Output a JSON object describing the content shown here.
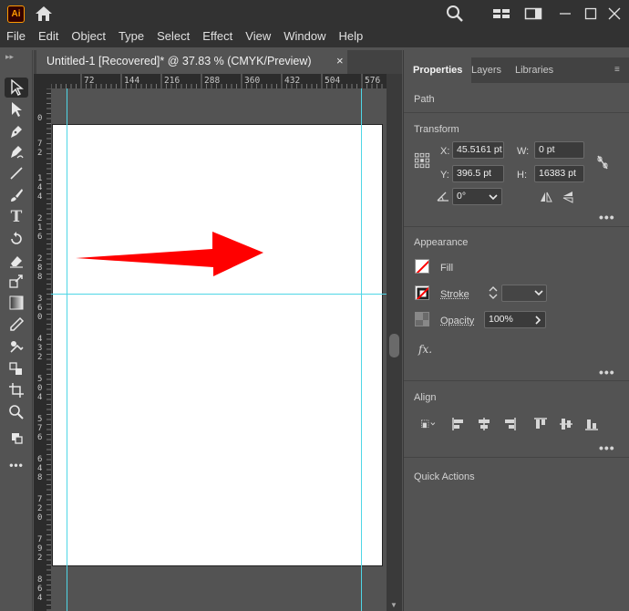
{
  "app": {
    "logo_text": "Ai"
  },
  "menu": [
    "File",
    "Edit",
    "Object",
    "Type",
    "Select",
    "Effect",
    "View",
    "Window",
    "Help"
  ],
  "document": {
    "tab_title": "Untitled-1 [Recovered]* @ 37.83 % (CMYK/Preview)",
    "close_glyph": "×"
  },
  "ruler": {
    "h_labels": [
      "72",
      "144",
      "216",
      "288",
      "360",
      "432",
      "504",
      "576"
    ],
    "v_labels": [
      "0",
      "7\n2",
      "1\n4\n4",
      "2\n1\n6",
      "2\n8\n8",
      "3\n6\n0",
      "4\n3\n2",
      "5\n0\n4",
      "5\n7\n6",
      "6\n4\n8",
      "7\n2\n0",
      "7\n9\n2",
      "8\n6\n4"
    ]
  },
  "canvas": {
    "arrow_color": "#ff0000",
    "guide_color": "#4fd6e6"
  },
  "panel": {
    "tabs": [
      "Properties",
      "Layers",
      "Libraries"
    ],
    "path_label": "Path",
    "transform": {
      "title": "Transform",
      "x_label": "X:",
      "x_value": "45.5161 pt",
      "y_label": "Y:",
      "y_value": "396.5 pt",
      "w_label": "W:",
      "w_value": "0 pt",
      "h_label": "H:",
      "h_value": "16383 pt",
      "angle_value": "0°"
    },
    "appearance": {
      "title": "Appearance",
      "fill_label": "Fill",
      "stroke_label": "Stroke",
      "opacity_label": "Opacity",
      "opacity_value": "100%",
      "fx_label": "fx."
    },
    "align": {
      "title": "Align"
    },
    "quick_actions": {
      "title": "Quick Actions"
    },
    "more_glyph": "•••"
  }
}
